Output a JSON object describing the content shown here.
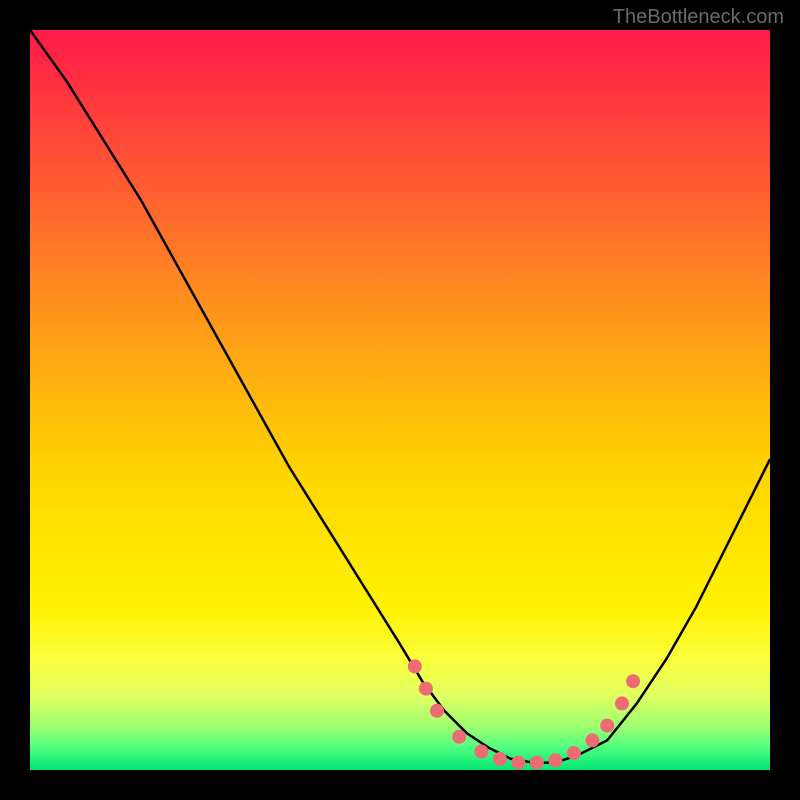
{
  "watermark": "TheBottleneck.com",
  "chart_data": {
    "type": "line",
    "title": "",
    "xlabel": "",
    "ylabel": "",
    "xlim": [
      0,
      100
    ],
    "ylim": [
      0,
      100
    ],
    "series": [
      {
        "name": "curve",
        "x": [
          0,
          5,
          10,
          15,
          20,
          25,
          30,
          35,
          40,
          45,
          50,
          53,
          56,
          59,
          62,
          65,
          68,
          71,
          74,
          78,
          82,
          86,
          90,
          94,
          98,
          100
        ],
        "y": [
          100,
          93,
          85,
          77,
          68,
          59,
          50,
          41,
          33,
          25,
          17,
          12,
          8,
          5,
          3,
          1.5,
          1,
          1,
          2,
          4,
          9,
          15,
          22,
          30,
          38,
          42
        ]
      }
    ],
    "markers": {
      "name": "dots",
      "x": [
        52,
        53.5,
        55,
        58,
        61,
        63.5,
        66,
        68.5,
        71,
        73.5,
        76,
        78,
        80,
        81.5
      ],
      "y": [
        14,
        11,
        8,
        4.5,
        2.5,
        1.5,
        1,
        1,
        1.3,
        2.3,
        4,
        6,
        9,
        12
      ]
    },
    "gradient_stops": [
      {
        "pos": 0,
        "color": "#ff1a4a"
      },
      {
        "pos": 60,
        "color": "#ffd500"
      },
      {
        "pos": 100,
        "color": "#00e676"
      }
    ]
  }
}
